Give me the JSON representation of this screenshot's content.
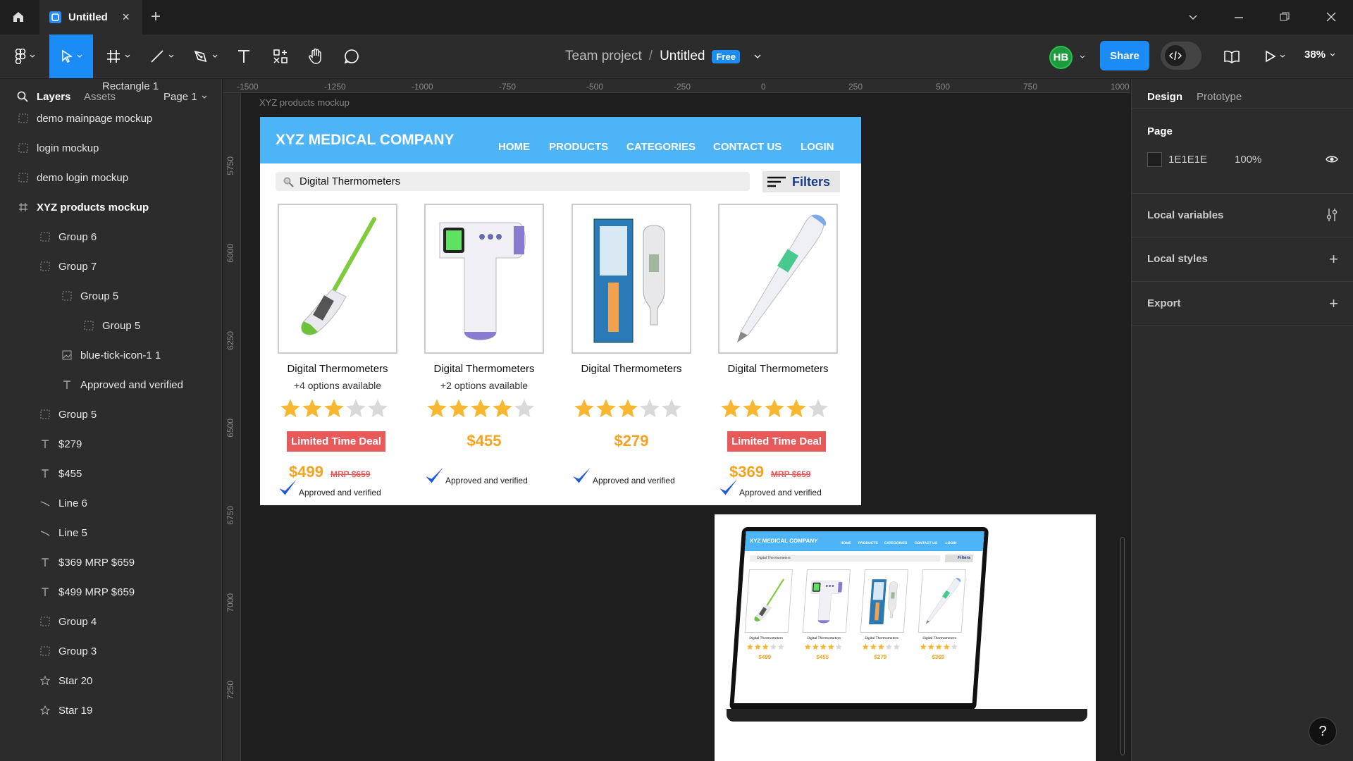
{
  "app": {
    "tab_title": "Untitled",
    "tab_close": "×",
    "new_tab": "+"
  },
  "toolbar": {
    "project": "Team project",
    "separator": "/",
    "file": "Untitled",
    "plan_badge": "Free",
    "avatar_initials": "HB",
    "share_label": "Share",
    "zoom": "38%"
  },
  "left_panel": {
    "tab_layers": "Layers",
    "tab_assets": "Assets",
    "page_selector": "Page 1",
    "layers": [
      {
        "label": "Rectangle 1",
        "icon": "rect-icon",
        "indent": 3
      },
      {
        "label": "demo mainpage mockup",
        "icon": "group-icon",
        "indent": 0
      },
      {
        "label": "login mockup",
        "icon": "group-icon",
        "indent": 0
      },
      {
        "label": "demo login mockup",
        "icon": "group-icon",
        "indent": 0
      },
      {
        "label": "XYZ products mockup",
        "icon": "frame-icon",
        "indent": 0
      },
      {
        "label": "Group 6",
        "icon": "group-icon",
        "indent": 1
      },
      {
        "label": "Group 7",
        "icon": "group-icon",
        "indent": 1
      },
      {
        "label": "Group 5",
        "icon": "group-icon",
        "indent": 2
      },
      {
        "label": "Group 5",
        "icon": "group-icon",
        "indent": 3
      },
      {
        "label": "blue-tick-icon-1 1",
        "icon": "image-icon",
        "indent": 2
      },
      {
        "label": "Approved and verified",
        "icon": "text-icon",
        "indent": 2
      },
      {
        "label": "Group 5",
        "icon": "group-icon",
        "indent": 1
      },
      {
        "label": "$279",
        "icon": "text-icon",
        "indent": 1
      },
      {
        "label": "$455",
        "icon": "text-icon",
        "indent": 1
      },
      {
        "label": "Line 6",
        "icon": "line-icon",
        "indent": 1
      },
      {
        "label": "Line 5",
        "icon": "line-icon",
        "indent": 1
      },
      {
        "label": "$369 MRP $659",
        "icon": "text-icon",
        "indent": 1
      },
      {
        "label": "$499 MRP $659",
        "icon": "text-icon",
        "indent": 1
      },
      {
        "label": "Group 4",
        "icon": "group-icon",
        "indent": 1
      },
      {
        "label": "Group 3",
        "icon": "group-icon",
        "indent": 1
      },
      {
        "label": "Star 20",
        "icon": "star-icon",
        "indent": 1
      },
      {
        "label": "Star 19",
        "icon": "star-icon",
        "indent": 1
      }
    ]
  },
  "canvas": {
    "ruler_x": [
      "-1500",
      "-1250",
      "-1000",
      "-750",
      "-500",
      "-250",
      "0",
      "250",
      "500",
      "750",
      "1000"
    ],
    "ruler_y": [
      "5750",
      "6000",
      "6250",
      "6500",
      "6750",
      "7000",
      "7250"
    ],
    "frame_label": "XYZ products mockup",
    "mockup": {
      "brand": "XYZ MEDICAL COMPANY",
      "nav": [
        "HOME",
        "PRODUCTS",
        "CATEGORIES",
        "CONTACT US",
        "LOGIN"
      ],
      "search_value": "Digital Thermometers",
      "filter_label": "Filters",
      "products": [
        {
          "name": "Digital Thermometers",
          "options": "+4 options available",
          "rating": 3,
          "deal": "Limited Time Deal",
          "price": "$499",
          "mrp": "MRP $659",
          "verified": "Approved and verified",
          "kind": "flex-green"
        },
        {
          "name": "Digital Thermometers",
          "options": "+2 options available",
          "rating": 4,
          "deal": "",
          "price": "$455",
          "mrp": "",
          "verified": "Approved and verified",
          "kind": "infrared"
        },
        {
          "name": "Digital Thermometers",
          "options": "",
          "rating": 3,
          "deal": "",
          "price": "$279",
          "mrp": "",
          "verified": "Approved and verified",
          "kind": "boxed"
        },
        {
          "name": "Digital Thermometers",
          "options": "",
          "rating": 4,
          "deal": "Limited Time Deal",
          "price": "$369",
          "mrp": "MRP $659",
          "verified": "Approved and verified",
          "kind": "flex-blue"
        }
      ]
    }
  },
  "right_panel": {
    "tab_design": "Design",
    "tab_prototype": "Prototype",
    "page_title": "Page",
    "page_color": "1E1E1E",
    "page_opacity": "100%",
    "local_variables": "Local variables",
    "local_styles": "Local styles",
    "export": "Export",
    "help": "?"
  },
  "colors": {
    "accent": "#1b8cf5",
    "nav_blue": "#4db5f7",
    "deal_red": "#e85a5a",
    "price_orange": "#f5a320",
    "star": "#f7b731",
    "star_empty": "#d9d9d9"
  }
}
